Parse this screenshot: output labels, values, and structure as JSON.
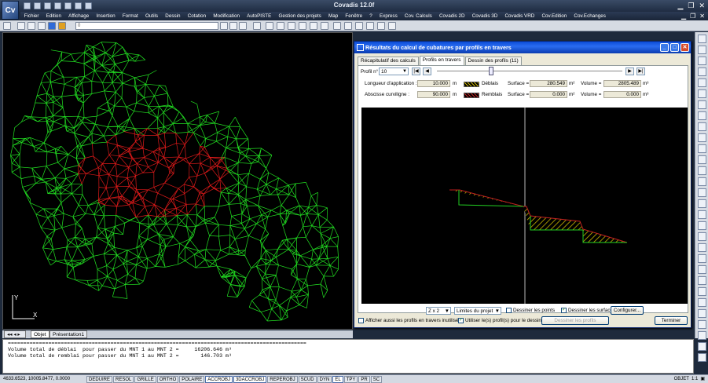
{
  "app": {
    "title": "Covadis 12.0f",
    "logo": "Cv"
  },
  "menu": [
    "Fichier",
    "Edition",
    "Affichage",
    "Insertion",
    "Format",
    "Outils",
    "Dessin",
    "Cotation",
    "Modification",
    "AutoPISTE",
    "Gestion des projets",
    "Map",
    "Fenêtre",
    "?",
    "Express",
    "Cov. Calculs",
    "Covadis 2D",
    "Covadis 3D",
    "Covadis VRD",
    "Cov.Edition",
    "Cov.Echanges"
  ],
  "toolbar": {
    "layer_value": "0"
  },
  "layout_tabs": [
    "Objet",
    "Présentation1"
  ],
  "dialog": {
    "title": "Résultats du calcul de cubatures par profils en travers",
    "tabs": [
      "Récapitulatif des calculs",
      "Profils en travers",
      "Dessin des profils (11)"
    ],
    "profile_label": "Profil n°",
    "profile_number": "10",
    "longueur_label": "Longueur d'application :",
    "longueur_value": "10.000",
    "longueur_unit": "m",
    "abscisse_label": "Abscisse curviligne :",
    "abscisse_value": "90.000",
    "abscisse_unit": "m",
    "deblais_label": "Déblais",
    "remblais_label": "Remblais",
    "surface_label": "Surface =",
    "volume_label": "Volume =",
    "deblais_surface": "280.549",
    "deblais_volume": "2805.489",
    "remblais_surface": "0.000",
    "remblais_volume": "0.000",
    "surface_unit": "m²",
    "volume_unit": "m³",
    "zoom": "Z x 2",
    "limits": "Limites du projet",
    "draw_points": "Dessiner les points",
    "draw_surfaces": "Dessiner les surfaces",
    "config_button": "Configurer...",
    "show_unused": "Afficher aussi les profils en travers inutilisés",
    "use_profiles": "Utiliser le(s) profil(s) pour le dessin",
    "draw_profile_button": "Dessiner les profils",
    "finish_button": "Terminer"
  },
  "command_line": {
    "separator": "================================================================================================",
    "line1": "Volume total de déblai  pour passer du MNT 1 au MNT 2 =     16206.646 m³",
    "line2": "Volume total de remblai pour passer du MNT 1 au MNT 2 =       146.703 m³"
  },
  "status": {
    "coords": "4633.6523, 10005.8477, 0.0000",
    "buttons": [
      "DEDUIRE",
      "RESOL",
      "GRILLE",
      "ORTHO",
      "POLAIRE",
      "ACCROBJ",
      "3DACCROBJ",
      "REPEROBJ",
      "SCUD",
      "DYN",
      "EL",
      "TPY",
      "PR",
      "SC"
    ],
    "active": [
      "ACCROBJ",
      "3DACCROBJ",
      "EL"
    ],
    "space": "OBJET",
    "scale": "1:1"
  },
  "colors": {
    "mesh_green": "#22e022",
    "mesh_red": "#e01a1a",
    "hatch": "#c8b400"
  }
}
